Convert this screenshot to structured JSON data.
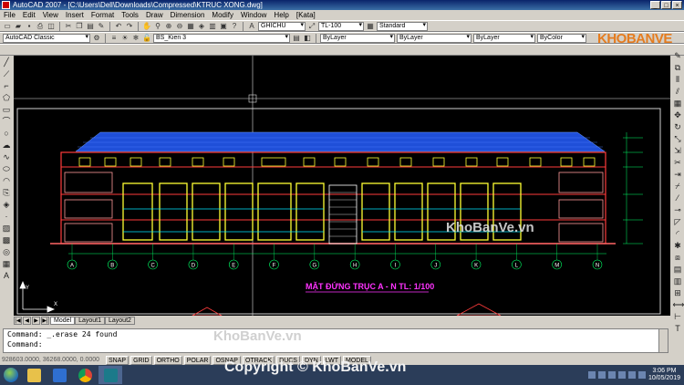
{
  "window": {
    "title": "AutoCAD 2007 - [C:\\Users\\Dell\\Downloads\\Compressed\\KTRUC XONG.dwg]",
    "controls": [
      "_",
      "□",
      "×"
    ]
  },
  "menu": [
    "File",
    "Edit",
    "View",
    "Insert",
    "Format",
    "Tools",
    "Draw",
    "Dimension",
    "Modify",
    "Window",
    "Help",
    "[Kata]"
  ],
  "toolbar1": {
    "text_style": "GHICHU",
    "dim_style": "TL-100",
    "table_style": "Standard"
  },
  "toolbar2": {
    "workspace": "AutoCAD Classic",
    "layer": "BS_Kien 3",
    "color": "ByLayer",
    "linetype": "ByLayer",
    "lineweight": "ByLayer",
    "plotstyle": "ByColor"
  },
  "logo": {
    "text": "KHOBANVE"
  },
  "drawing": {
    "title": "MẶT ĐỨNG TRỤC A - N   TL: 1/100",
    "grid_labels": [
      "A",
      "B",
      "C",
      "D",
      "E",
      "F",
      "G",
      "H",
      "I",
      "J",
      "K",
      "L",
      "M",
      "N"
    ],
    "watermark": "KhoBanVe.vn"
  },
  "layout_tabs": [
    "Model",
    "Layout1",
    "Layout2"
  ],
  "command": {
    "line1": "Command: _.erase 24 found",
    "line2": "Command:"
  },
  "status": {
    "coords": "928603.0000, 36268.0000, 0.0000",
    "buttons": [
      "SNAP",
      "GRID",
      "ORTHO",
      "POLAR",
      "OSNAP",
      "OTRACK",
      "DUCS",
      "DYN",
      "LWT",
      "MODEL"
    ]
  },
  "watermark_bottom": "KhoBanVe.vn",
  "copyright": "Copyright © KhoBanVe.vn",
  "taskbar": {
    "clock_time": "3:06 PM",
    "clock_date": "10/05/2019"
  },
  "colors": {
    "roof": "#1f4fd8",
    "wall": "#ff3b3b",
    "window": "#ffff33",
    "grid": "#00ff66",
    "title": "#ff33ff"
  }
}
